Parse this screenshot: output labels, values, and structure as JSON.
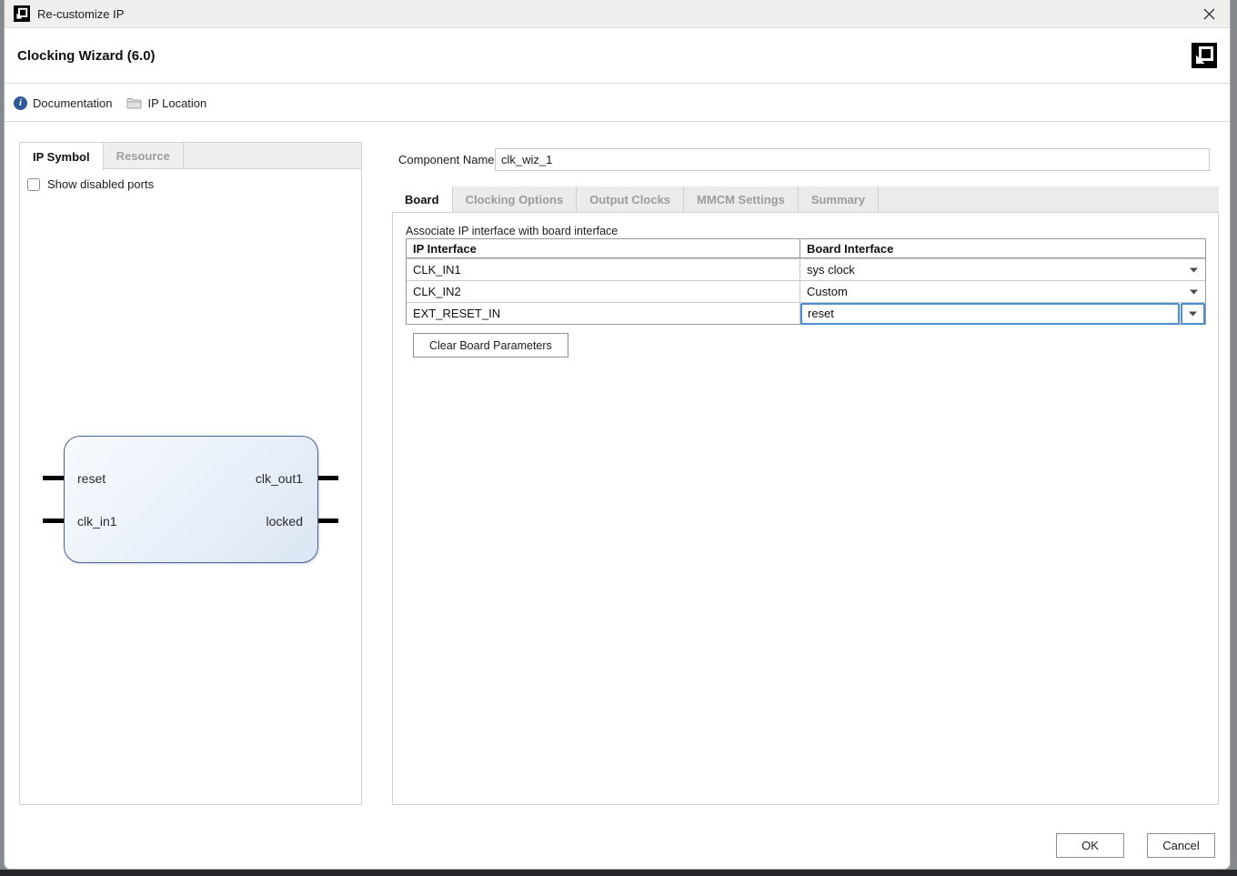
{
  "window": {
    "title": "Re-customize IP"
  },
  "header": {
    "title": "Clocking Wizard (6.0)"
  },
  "toolbar": {
    "documentation_label": "Documentation",
    "ip_location_label": "IP Location"
  },
  "left_panel": {
    "tabs": [
      {
        "label": "IP Symbol",
        "active": true
      },
      {
        "label": "Resource",
        "active": false
      }
    ],
    "show_disabled_ports_label": "Show disabled ports",
    "show_disabled_ports_checked": false,
    "ip_symbol": {
      "input_ports": [
        "reset",
        "clk_in1"
      ],
      "output_ports": [
        "clk_out1",
        "locked"
      ]
    }
  },
  "main": {
    "component_name_label": "Component Name",
    "component_name_value": "clk_wiz_1",
    "tabs": [
      {
        "label": "Board",
        "active": true
      },
      {
        "label": "Clocking Options",
        "active": false
      },
      {
        "label": "Output Clocks",
        "active": false
      },
      {
        "label": "MMCM Settings",
        "active": false
      },
      {
        "label": "Summary",
        "active": false
      }
    ],
    "board_tab": {
      "caption": "Associate IP interface with board interface",
      "table": {
        "col_headers": [
          "IP Interface",
          "Board Interface"
        ],
        "rows": [
          {
            "ip_interface": "CLK_IN1",
            "board_interface": "sys clock",
            "selected": false
          },
          {
            "ip_interface": "CLK_IN2",
            "board_interface": "Custom",
            "selected": false
          },
          {
            "ip_interface": "EXT_RESET_IN",
            "board_interface": "reset",
            "selected": true
          }
        ]
      },
      "clear_board_parameters_label": "Clear Board Parameters"
    }
  },
  "footer": {
    "ok_label": "OK",
    "cancel_label": "Cancel"
  },
  "icons": {
    "titlebar_icon": "xilinx-logo",
    "close": "x-cross",
    "documentation": "info-circle",
    "ip_location": "folder",
    "brand": "xilinx-amd-logo",
    "combo": "dropdown-arrow"
  },
  "colors": {
    "selection_blue": "#4a90d2",
    "block_border": "#46639b",
    "block_fill_light": "#f7fafd",
    "block_fill_dark": "#dbe5f3",
    "titlebar_bg": "#f0efee"
  }
}
